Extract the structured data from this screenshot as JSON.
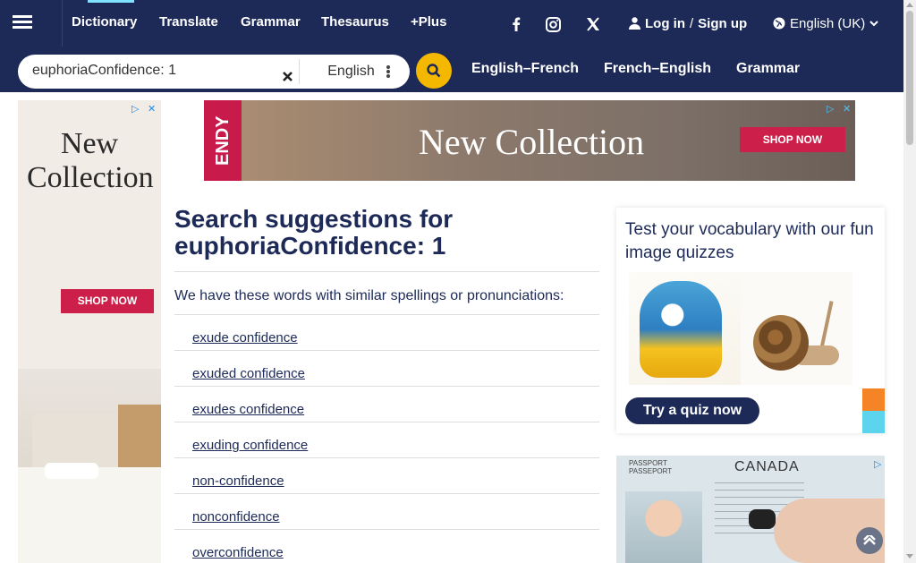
{
  "nav": {
    "items": [
      {
        "label": "Dictionary"
      },
      {
        "label": "Translate"
      },
      {
        "label": "Grammar"
      },
      {
        "label": "Thesaurus"
      },
      {
        "label": "+Plus"
      }
    ],
    "social": {
      "facebook": "facebook-icon",
      "instagram": "instagram-icon",
      "x": "x-icon"
    },
    "auth": {
      "login": "Log in",
      "separator": "/",
      "signup": "Sign up"
    },
    "language": "English (UK)"
  },
  "search": {
    "value": "euphoriaConfidence: 1",
    "dictionary": "English",
    "links": [
      {
        "label": "English–French"
      },
      {
        "label": "French–English"
      },
      {
        "label": "Grammar"
      }
    ]
  },
  "ads": {
    "left": {
      "title": "New Collection",
      "cta": "SHOP NOW"
    },
    "top": {
      "brand": "ENDY",
      "title": "New Collection",
      "cta": "SHOP NOW"
    },
    "passport": {
      "header1": "PASSPORT",
      "header2": "PASSEPORT",
      "country": "CANADA"
    }
  },
  "main": {
    "heading_prefix": "Search suggestions for",
    "heading_term": "euphoriaConfidence: 1",
    "intro": "We have these words with similar spellings or pronunciations:",
    "suggestions": [
      {
        "label": "exude confidence"
      },
      {
        "label": "exuded confidence"
      },
      {
        "label": "exudes confidence"
      },
      {
        "label": "exuding confidence"
      },
      {
        "label": "non-confidence"
      },
      {
        "label": "nonconfidence"
      },
      {
        "label": "overconfidence"
      }
    ]
  },
  "quiz": {
    "title": "Test your vocabulary with our fun image quizzes",
    "button": "Try a quiz now"
  },
  "colors": {
    "navy": "#1d2a57",
    "yellow": "#f4b800",
    "ad_red": "#cc1f4a"
  }
}
